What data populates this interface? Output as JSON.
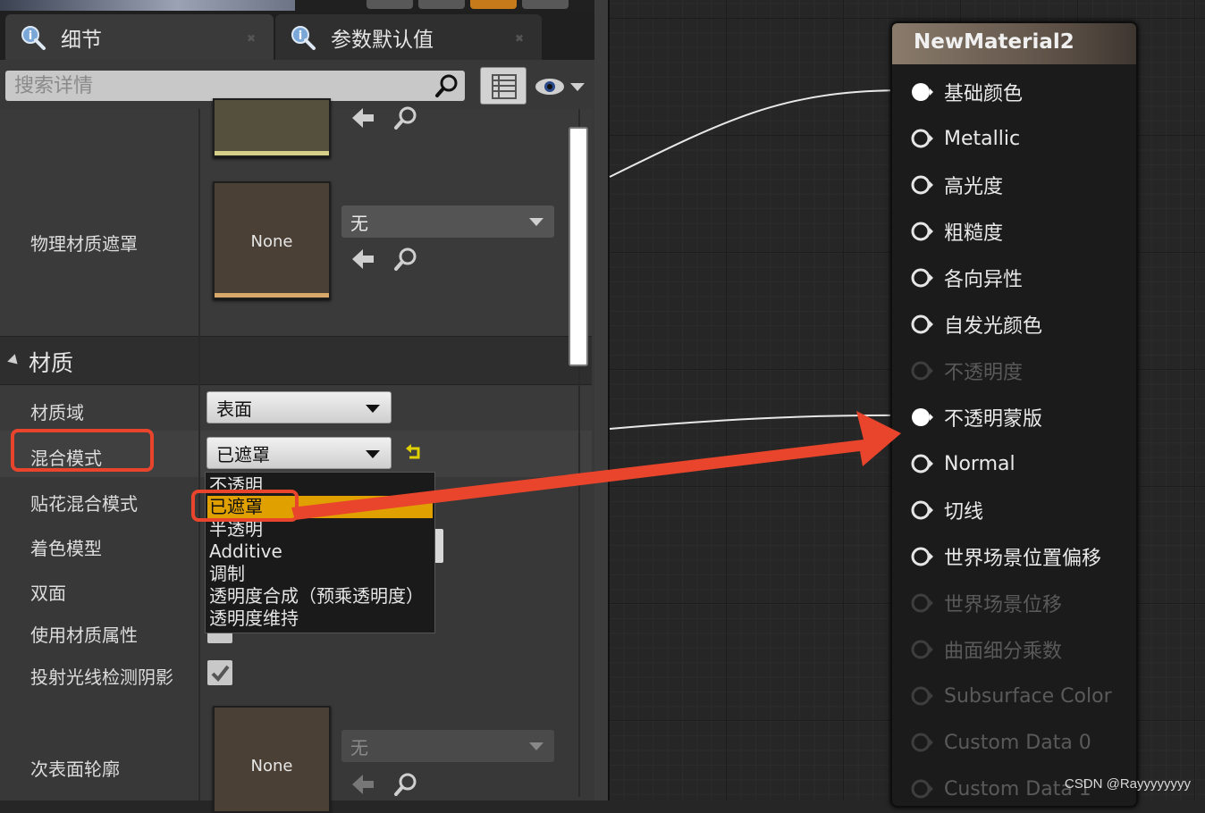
{
  "details_panel": {
    "tabs": [
      {
        "label": "细节",
        "icon": "magnifier-info-icon"
      },
      {
        "label": "参数默认值",
        "icon": "magnifier-info-icon"
      }
    ],
    "search": {
      "placeholder": "搜索详情"
    },
    "rows": {
      "phys_mask_label": "物理材质遮罩",
      "phys_mask_thumb": "None",
      "phys_mask_combo": "无",
      "section_title": "材质",
      "domain_label": "材质域",
      "domain_value": "表面",
      "blend_label": "混合模式",
      "blend_value": "已遮罩",
      "decal_blend_label": "贴花混合模式",
      "shading_label": "着色模型",
      "two_sided_label": "双面",
      "use_attr_label": "使用材质属性",
      "raytrace_shadow_label": "投射光线检测阴影",
      "subsurface_label": "次表面轮廓",
      "subsurface_thumb": "None",
      "subsurface_combo": "无"
    },
    "blend_dropdown": {
      "options": [
        "不透明",
        "已遮罩",
        "半透明",
        "Additive",
        "调制",
        "透明度合成（预乘透明度）",
        "透明度维持"
      ],
      "selected": "已遮罩"
    },
    "colors": {
      "accent_selected": "#e0a000",
      "highlight": "#e8452c"
    }
  },
  "node": {
    "title": "NewMaterial2",
    "pins": [
      {
        "label": "基础颜色",
        "state": "connected"
      },
      {
        "label": "Metallic",
        "state": "enabled"
      },
      {
        "label": "高光度",
        "state": "enabled"
      },
      {
        "label": "粗糙度",
        "state": "enabled"
      },
      {
        "label": "各向异性",
        "state": "enabled"
      },
      {
        "label": "自发光颜色",
        "state": "enabled"
      },
      {
        "label": "不透明度",
        "state": "disabled"
      },
      {
        "label": "不透明蒙版",
        "state": "connected"
      },
      {
        "label": "Normal",
        "state": "enabled"
      },
      {
        "label": "切线",
        "state": "enabled"
      },
      {
        "label": "世界场景位置偏移",
        "state": "enabled"
      },
      {
        "label": "世界场景位移",
        "state": "disabled"
      },
      {
        "label": "曲面细分乘数",
        "state": "disabled"
      },
      {
        "label": "Subsurface Color",
        "state": "disabled"
      },
      {
        "label": "Custom Data 0",
        "state": "disabled"
      },
      {
        "label": "Custom Data 1",
        "state": "disabled"
      }
    ]
  },
  "watermark": "CSDN @Rayyyyyyyy"
}
